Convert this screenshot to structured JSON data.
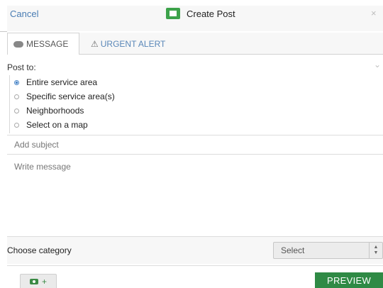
{
  "header": {
    "cancel_label": "Cancel",
    "title": "Create Post",
    "close_label": "×"
  },
  "tabs": [
    {
      "label": "MESSAGE",
      "icon": "speech-bubble-icon",
      "active": true
    },
    {
      "label": "URGENT ALERT",
      "icon": "warning-icon",
      "active": false
    }
  ],
  "post_to": {
    "label": "Post to:",
    "options": [
      {
        "label": "Entire service area",
        "selected": true
      },
      {
        "label": "Specific service area(s)",
        "selected": false
      },
      {
        "label": "Neighborhoods",
        "selected": false
      },
      {
        "label": "Select on a map",
        "selected": false
      }
    ]
  },
  "subject": {
    "placeholder": "Add subject",
    "value": ""
  },
  "message": {
    "placeholder": "Write message",
    "value": ""
  },
  "category": {
    "label": "Choose category",
    "selected": "Select"
  },
  "footer": {
    "photo_plus": "+",
    "preview_label": "PREVIEW"
  },
  "colors": {
    "accent_green": "#2f8a45",
    "link_blue": "#4a7db3",
    "radio_blue": "#4a86c8"
  }
}
